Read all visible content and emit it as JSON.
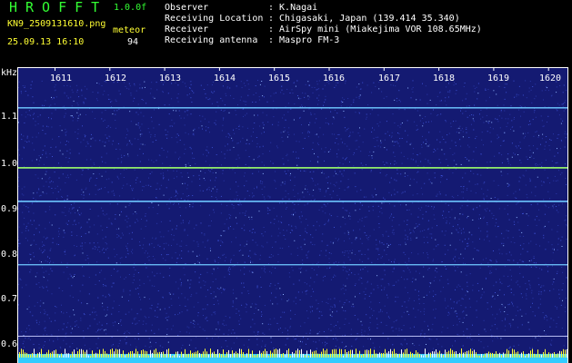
{
  "header": {
    "app_name": "HROFFT",
    "version": "1.0.0f",
    "filename": "KN9_2509131610.png",
    "datetime": "25.09.13 16:10",
    "meteor_label": "meteor",
    "meteor_count": "94"
  },
  "info": [
    {
      "label": "Observer",
      "value": ": K.Nagai"
    },
    {
      "label": "Receiving Location",
      "value": ": Chigasaki, Japan (139.414 35.340)"
    },
    {
      "label": "Receiver",
      "value": ": AirSpy mini (Miakejima VOR 108.65MHz)"
    },
    {
      "label": "Receiving antenna",
      "value": ": Maspro FM-3"
    }
  ],
  "plot": {
    "y_unit": "kHz",
    "y_ticks": [
      "1.1",
      "1.0",
      "0.9",
      "0.8",
      "0.7",
      "0.6"
    ],
    "x_ticks": [
      "1611",
      "1612",
      "1613",
      "1614",
      "1615",
      "1616",
      "1617",
      "1618",
      "1619",
      "1620"
    ],
    "colors": {
      "background": "#141a72",
      "noise": "#3b4fd0",
      "signal": "#6ec8ff",
      "carrier": "#9cff6a",
      "bottom_band": "#ffff33",
      "bottom_base": "#33ccff"
    }
  }
}
